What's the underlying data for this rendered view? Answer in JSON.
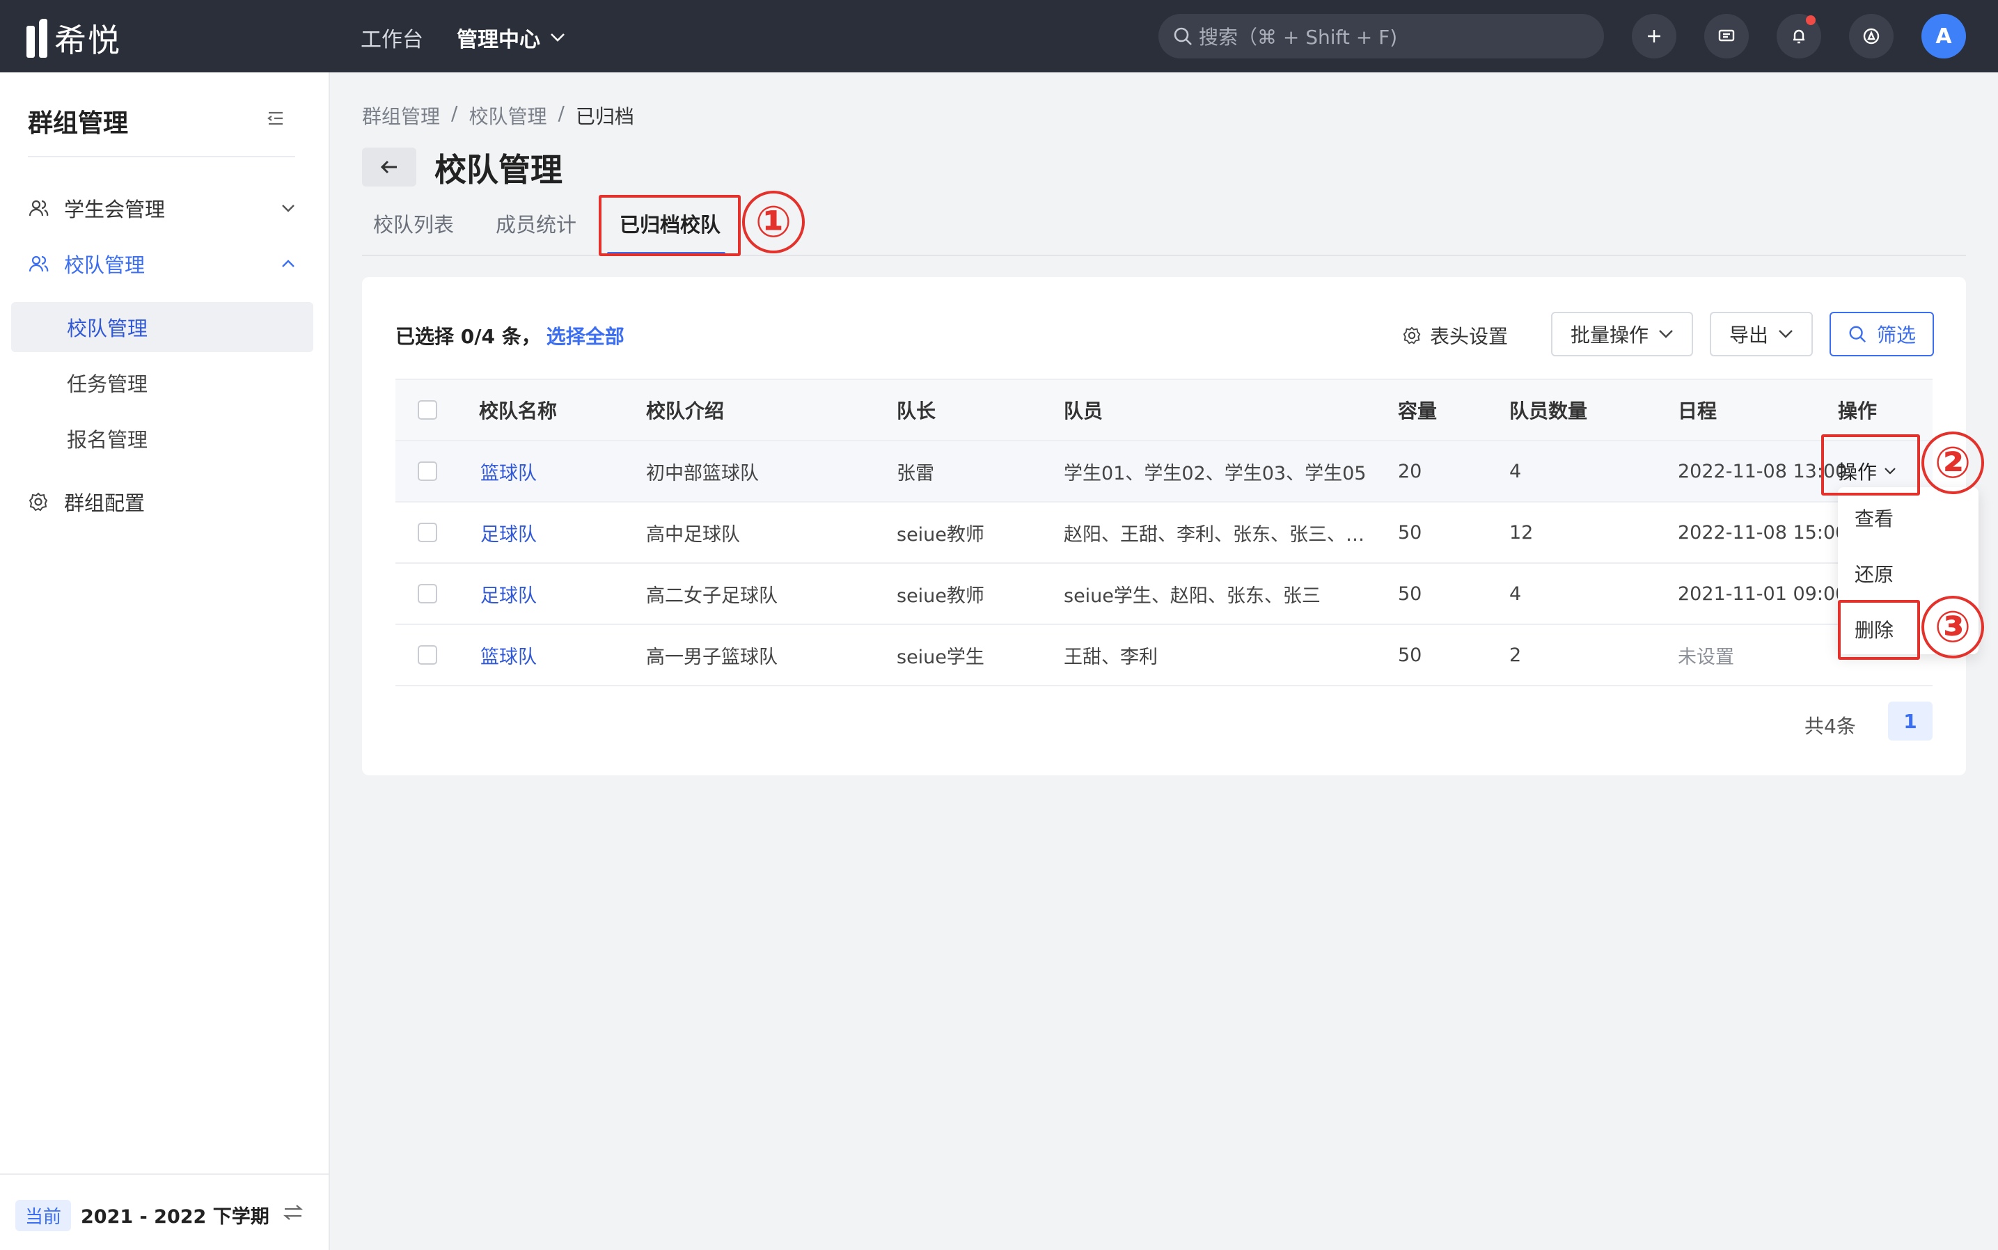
{
  "topbar": {
    "logo_text": "希悦",
    "nav": [
      "工作台",
      "管理中心"
    ],
    "search_placeholder": "搜索（⌘ + Shift + F)",
    "avatar_letter": "A"
  },
  "sidebar": {
    "title": "群组管理",
    "menu": [
      {
        "label": "学生会管理"
      },
      {
        "label": "校队管理"
      },
      {
        "label": "群组配置"
      }
    ],
    "submenu": [
      "校队管理",
      "任务管理",
      "报名管理"
    ],
    "footer": {
      "badge": "当前",
      "term": "2021 - 2022 下学期"
    }
  },
  "breadcrumb": [
    "群组管理",
    "校队管理",
    "已归档"
  ],
  "page_title": "校队管理",
  "tabs": [
    "校队列表",
    "成员统计",
    "已归档校队"
  ],
  "annotations": [
    "①",
    "②",
    "③"
  ],
  "toolbar": {
    "selected_prefix": "已选择 0/4 条，",
    "select_all": "选择全部",
    "header_settings": "表头设置",
    "batch": "批量操作",
    "export": "导出",
    "filter": "筛选"
  },
  "table": {
    "columns": [
      "校队名称",
      "校队介绍",
      "队长",
      "队员",
      "容量",
      "队员数量",
      "日程",
      "操作"
    ],
    "rows": [
      {
        "name": "篮球队",
        "intro": "初中部篮球队",
        "captain": "张雷",
        "members": "学生01、学生02、学生03、学生05",
        "capacity": "20",
        "count": "4",
        "schedule": "2022-11-08 13:00",
        "op": "操作"
      },
      {
        "name": "足球队",
        "intro": "高中足球队",
        "captain": "seiue教师",
        "members": "赵阳、王甜、李利、张东、张三、…",
        "capacity": "50",
        "count": "12",
        "schedule": "2022-11-08 15:00"
      },
      {
        "name": "足球队",
        "intro": "高二女子足球队",
        "captain": "seiue教师",
        "members": "seiue学生、赵阳、张东、张三",
        "capacity": "50",
        "count": "4",
        "schedule": "2021-11-01 09:00"
      },
      {
        "name": "篮球队",
        "intro": "高一男子篮球队",
        "captain": "seiue学生",
        "members": "王甜、李利",
        "capacity": "50",
        "count": "2",
        "schedule": "未设置"
      }
    ]
  },
  "dropdown": [
    "查看",
    "还原",
    "删除"
  ],
  "pager": {
    "total": "共4条",
    "page": "1"
  }
}
